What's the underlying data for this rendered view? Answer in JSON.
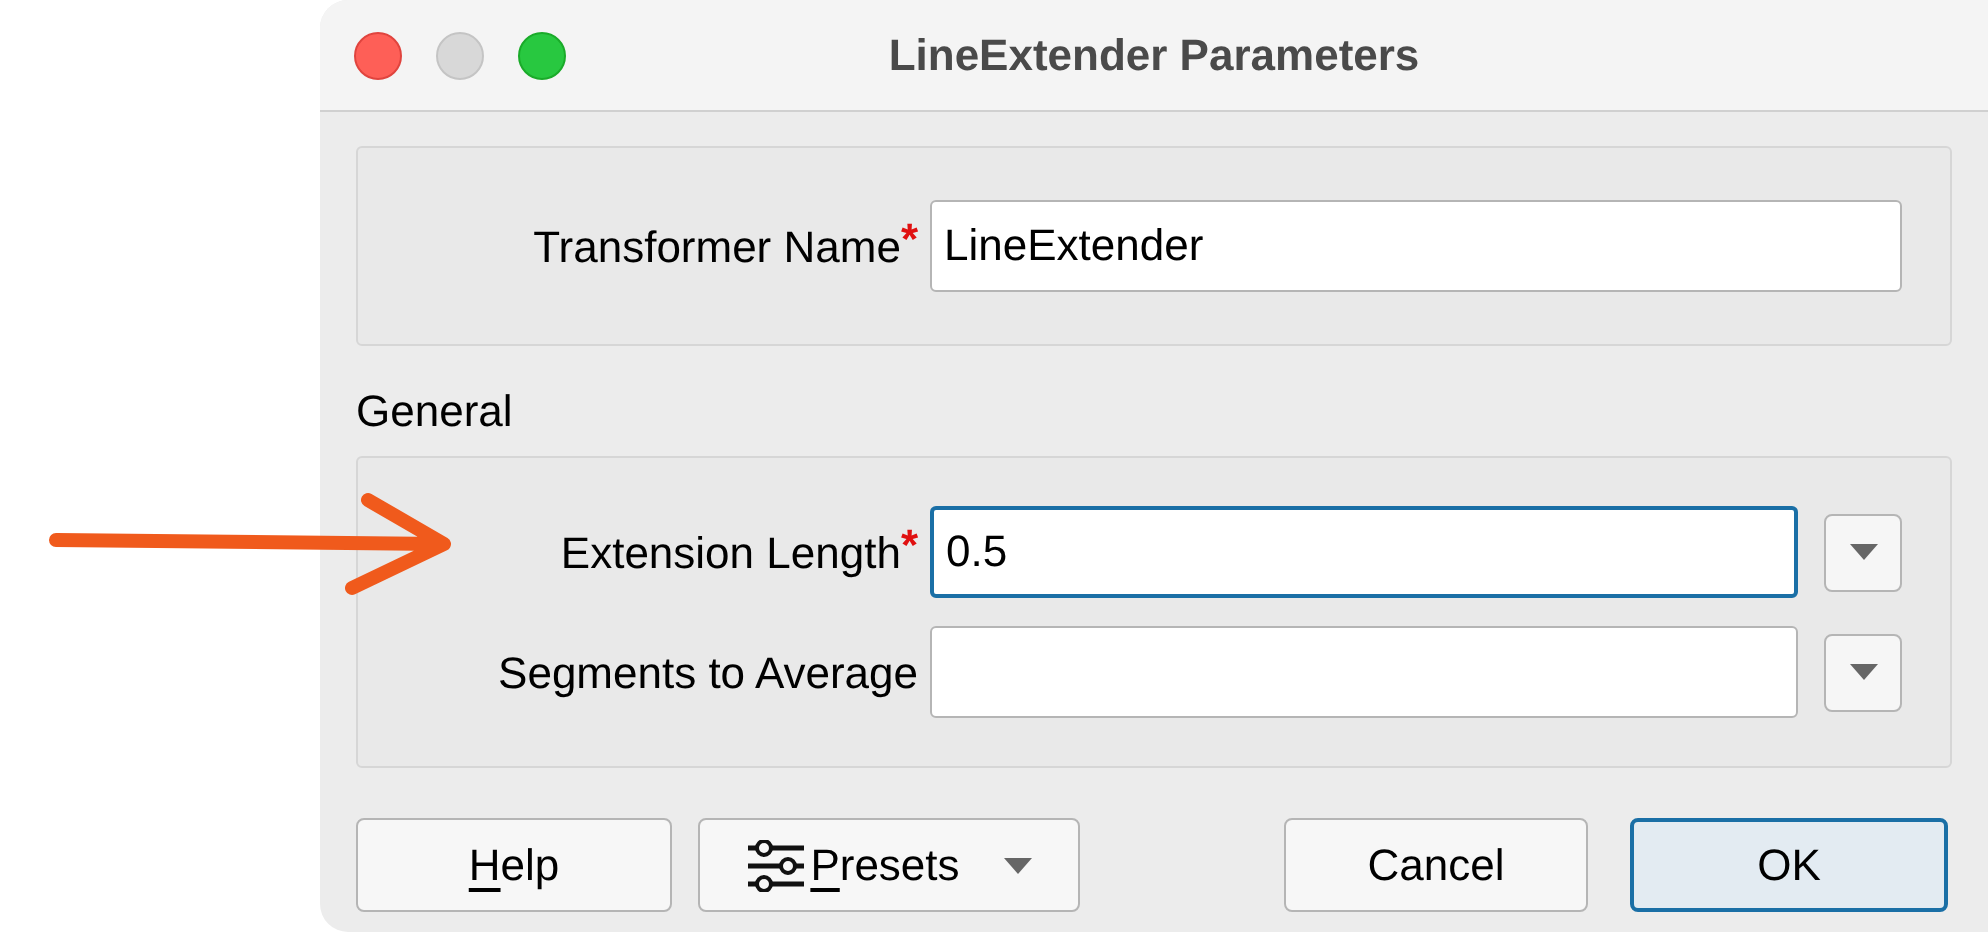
{
  "window": {
    "title": "LineExtender Parameters"
  },
  "transformer_name": {
    "label": "Transformer Name",
    "required_mark": "*",
    "value": "LineExtender"
  },
  "general": {
    "title": "General",
    "parameters": [
      {
        "label": "Extension Length",
        "required_mark": "*",
        "value": "0.5",
        "focused": true
      },
      {
        "label": "Segments to Average",
        "focused": false
      }
    ]
  },
  "buttons": [
    {
      "kind": "plain",
      "parts": [
        {
          "text": "H",
          "underlined": true
        },
        {
          "text": "elp",
          "underlined": false
        }
      ],
      "default": false
    },
    {
      "kind": "menu",
      "parts": [
        {
          "text": "P",
          "underlined": true
        },
        {
          "text": "resets",
          "underlined": false
        }
      ],
      "default": false
    },
    {
      "kind": "spacer"
    },
    {
      "kind": "plain",
      "parts": [
        {
          "text": "Cancel",
          "underlined": false
        }
      ],
      "default": false
    },
    {
      "kind": "plain",
      "parts": [
        {
          "text": "OK",
          "underlined": false
        }
      ],
      "default": true
    }
  ]
}
